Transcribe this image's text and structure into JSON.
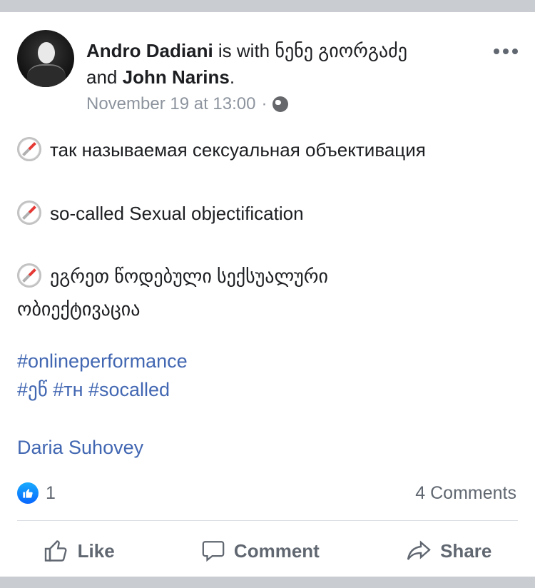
{
  "post": {
    "author": "Andro Dadiani",
    "with_text": " is with ",
    "tag1": "ნენე გიორგაძე",
    "and_text": "and ",
    "tag2": "John Narins",
    "period": ".",
    "timestamp": "November 19 at 13:00",
    "separator": "·",
    "lines": [
      "так называемая сексуальная объективация",
      "so-called Sexual objectification",
      "ეგრეთ წოდებული სექსუალური",
      "ობიექტივაცია"
    ],
    "hashtags": [
      "#onlineperformance",
      "#ეწ #тн #socalled"
    ],
    "tagged_people": "Daria  Suhovey",
    "like_count": "1",
    "comments": "4 Comments"
  },
  "actions": {
    "like": "Like",
    "comment": "Comment",
    "share": "Share"
  },
  "icons": [
    "globe-icon",
    "more-icon",
    "compass-icon",
    "like-badge-icon",
    "thumbs-up-icon",
    "comment-icon",
    "share-icon"
  ],
  "colors": {
    "link": "#4267b2",
    "muted": "#8d949e",
    "text": "#1c1e21",
    "like_blue": "#0866ff"
  }
}
